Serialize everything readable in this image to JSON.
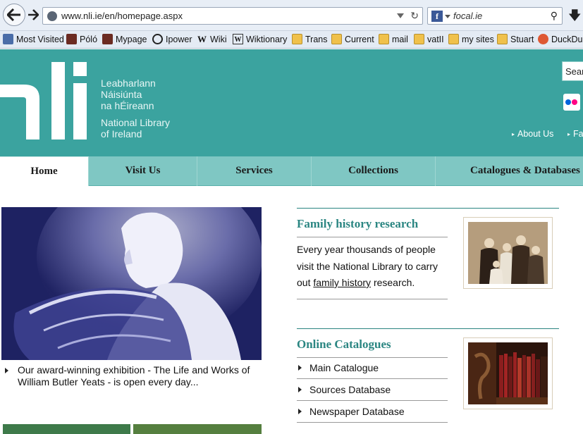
{
  "browser": {
    "url": "www.nli.ie/en/homepage.aspx",
    "search_text": "focal.ie",
    "bookmarks": [
      {
        "label": "Most Visited",
        "icon": "most-visited-icon"
      },
      {
        "label": "Póló",
        "icon": "picture-icon"
      },
      {
        "label": "Mypage",
        "icon": "picture-icon"
      },
      {
        "label": "Ipower",
        "icon": "power-icon"
      },
      {
        "label": "Wiki",
        "icon": "wikipedia-icon"
      },
      {
        "label": "Wiktionary",
        "icon": "wiktionary-icon"
      },
      {
        "label": "Trans",
        "icon": "folder-icon"
      },
      {
        "label": "Current",
        "icon": "folder-icon"
      },
      {
        "label": "mail",
        "icon": "folder-icon"
      },
      {
        "label": "vatII",
        "icon": "folder-icon"
      },
      {
        "label": "my sites",
        "icon": "folder-icon"
      },
      {
        "label": "Stuart",
        "icon": "folder-icon"
      },
      {
        "label": "DuckDuc",
        "icon": "duckduckgo-icon"
      }
    ]
  },
  "site": {
    "logo_text": "nli",
    "library_name": {
      "irish_1": "Leabharlann",
      "irish_2": "Náisiúnta",
      "irish_3": "na hÉireann",
      "english_1": "National Library",
      "english_2": "of Ireland"
    },
    "search_placeholder": "Sear",
    "utility_links": [
      "About Us",
      "Fa"
    ],
    "colors": {
      "header": "#3ba39f",
      "nav": "#7fc7c3",
      "accent": "#2b8682"
    }
  },
  "nav": {
    "tabs": [
      "Home",
      "Visit Us",
      "Services",
      "Collections",
      "Catalogues & Databases"
    ],
    "active": "Home"
  },
  "main": {
    "hero_caption": "Our award-winning exhibition - The Life and Works of William Butler Yeats - is open every day...",
    "family": {
      "title": "Family history research",
      "text_before": "Every year thousands of people visit the National Library to carry out",
      "link": "family history",
      "text_after": "research."
    },
    "catalogues": {
      "title": "Online Catalogues",
      "items": [
        "Main Catalogue",
        "Sources Database",
        "Newspaper Database"
      ]
    }
  }
}
